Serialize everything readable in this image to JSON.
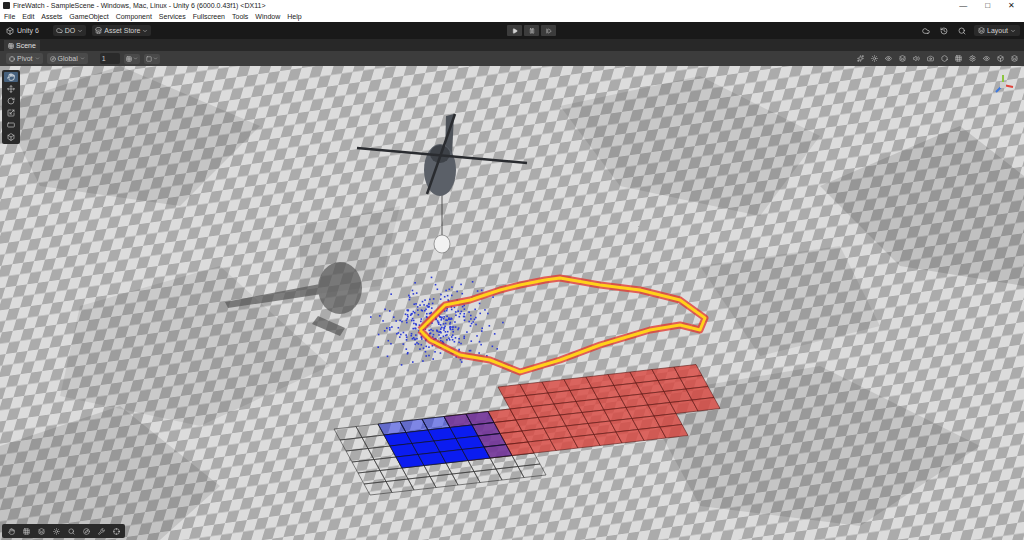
{
  "window": {
    "title": "FireWatch - SampleScene - Windows, Mac, Linux - Unity 6 (6000.0.43f1) <DX11>",
    "controls": [
      "—",
      "□",
      "✕"
    ]
  },
  "menu": [
    "File",
    "Edit",
    "Assets",
    "GameObject",
    "Component",
    "Services",
    "Fullscreen",
    "Tools",
    "Window",
    "Help"
  ],
  "toolbar": {
    "product": "Unity 6",
    "account": "DO",
    "store": "Asset Store",
    "layout": "Layout",
    "play_mode": {
      "playing": false,
      "paused": false
    }
  },
  "tabs": [
    {
      "label": "Scene",
      "selected": true
    }
  ],
  "scene_toolbar": {
    "pivot": "Pivot",
    "space": "Global",
    "grid_size": "1"
  },
  "tools": [
    {
      "selected": true
    },
    {
      "selected": false
    },
    {
      "selected": false
    },
    {
      "selected": false
    },
    {
      "selected": false
    },
    {
      "selected": false
    }
  ],
  "overlay_tools": [
    {
      "selected": false
    },
    {
      "selected": false
    },
    {
      "selected": false
    },
    {
      "selected": false
    },
    {
      "selected": false
    },
    {
      "selected": false
    },
    {
      "selected": false
    },
    {
      "selected": false
    }
  ]
}
